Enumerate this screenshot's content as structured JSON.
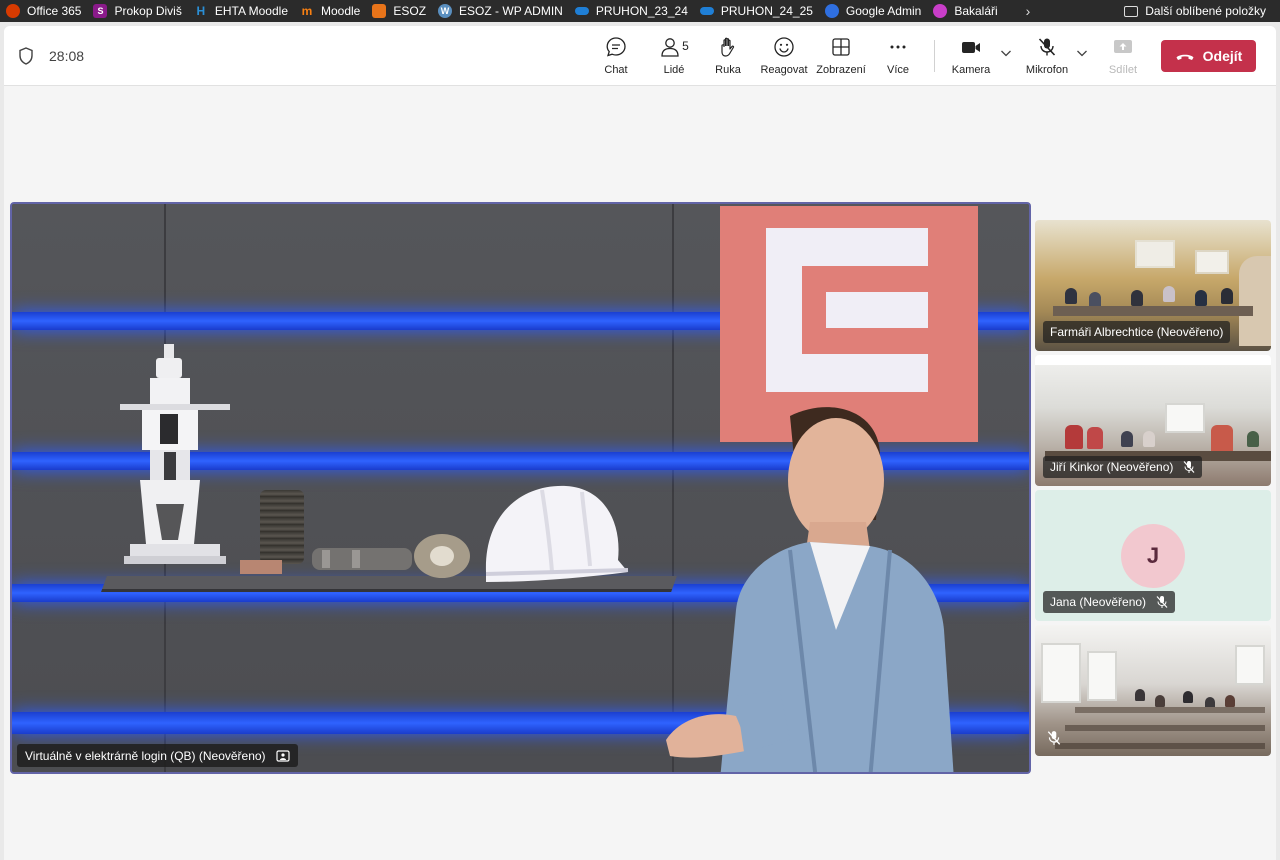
{
  "bookmarks": {
    "items": [
      {
        "label": "Office 365",
        "icon": "office-icon",
        "color": "#d83b01"
      },
      {
        "label": "Prokop Diviš",
        "icon": "prokop-icon",
        "color": "#8a1a8a"
      },
      {
        "label": "EHTA Moodle",
        "icon": "h2-icon",
        "color": "#2b8fd6"
      },
      {
        "label": "Moodle",
        "icon": "moodle-icon",
        "color": "#f98012"
      },
      {
        "label": "ESOZ",
        "icon": "esoz-icon",
        "color": "#e8741a"
      },
      {
        "label": "ESOZ - WP ADMIN",
        "icon": "wordpress-icon",
        "color": "#5a8fbf"
      },
      {
        "label": "PRUHON_23_24",
        "icon": "onedrive-icon",
        "color": "#1f7fd6"
      },
      {
        "label": "PRUHON_24_25",
        "icon": "onedrive-icon",
        "color": "#1f7fd6"
      },
      {
        "label": "Google Admin",
        "icon": "google-admin-icon",
        "color": "#2f6fe0"
      },
      {
        "label": "Bakaláři",
        "icon": "bakalari-icon",
        "color": "#c93ec9"
      }
    ],
    "more_glyph": "›",
    "other_label": "Další oblíbené položky"
  },
  "topbar": {
    "timer": "28:08",
    "chat_label": "Chat",
    "people_label": "Lidé",
    "people_count": "5",
    "hand_label": "Ruka",
    "react_label": "Reagovat",
    "view_label": "Zobrazení",
    "more_label": "Více",
    "camera_label": "Kamera",
    "mic_label": "Mikrofon",
    "share_label": "Sdílet",
    "leave_label": "Odejít",
    "leave_color": "#c4314b"
  },
  "stage": {
    "label": "Virtuálně v elektrárně login (QB) (Neověřeno)",
    "border_color": "#6264a7"
  },
  "participants": [
    {
      "name": "Farmáři Albrechtice (Neověřeno)",
      "muted": false
    },
    {
      "name": "Jiří Kinkor (Neověřeno)",
      "muted": true
    },
    {
      "name": "Jana (Neověřeno)",
      "muted": true,
      "initial": "J"
    },
    {
      "name": "",
      "muted": true
    }
  ]
}
